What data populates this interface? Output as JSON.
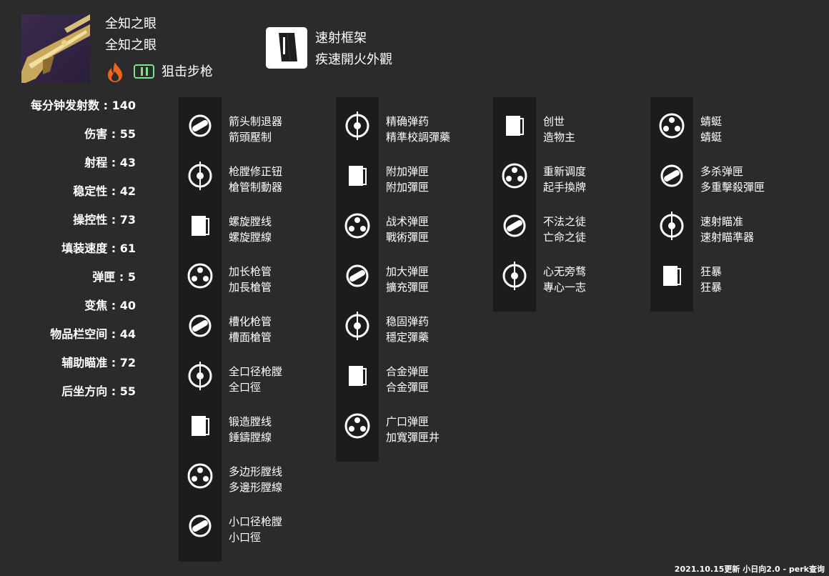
{
  "weapon": {
    "name_cn": "全知之眼",
    "name_tw": "全知之眼",
    "type": "狙击步枪",
    "element": "solar-icon",
    "ammo": "special-ammo-icon",
    "colors": {
      "solar": "#f0631e",
      "special": "#7be38c",
      "image_bg": "#3b2b4e"
    }
  },
  "frame": {
    "icon": "rapid-fire-frame-icon",
    "name_cn": "速射框架",
    "name_tw": "疾速開火外觀"
  },
  "stats": [
    {
      "label": "每分钟发射数",
      "value": "140"
    },
    {
      "label": "伤害",
      "value": "55"
    },
    {
      "label": "射程",
      "value": "43"
    },
    {
      "label": "稳定性",
      "value": "42"
    },
    {
      "label": "操控性",
      "value": "73"
    },
    {
      "label": "填装速度",
      "value": "61"
    },
    {
      "label": "弹匣",
      "value": "5"
    },
    {
      "label": "变焦",
      "value": "40"
    },
    {
      "label": "物品栏空间",
      "value": "44"
    },
    {
      "label": "辅助瞄准",
      "value": "72"
    },
    {
      "label": "后坐方向",
      "value": "55"
    }
  ],
  "columns": [
    {
      "id": "barrels",
      "perks": [
        {
          "cn": "箭头制退器",
          "tw": "箭頭壓制",
          "icon": "arrowhead-brake-icon"
        },
        {
          "cn": "枪膛修正钮",
          "tw": "槍管制動器",
          "icon": "corkscrew-rifling-icon"
        },
        {
          "cn": "螺旋膛线",
          "tw": "螺旋膛線",
          "icon": "rifling-icon"
        },
        {
          "cn": "加长枪管",
          "tw": "加長槍管",
          "icon": "extended-barrel-icon"
        },
        {
          "cn": "槽化枪管",
          "tw": "槽面槍管",
          "icon": "fluted-barrel-icon"
        },
        {
          "cn": "全口径枪膛",
          "tw": "全口徑",
          "icon": "full-bore-icon"
        },
        {
          "cn": "锻造膛线",
          "tw": "錘鑄膛線",
          "icon": "hammer-forged-icon"
        },
        {
          "cn": "多边形膛线",
          "tw": "多邊形膛線",
          "icon": "polygonal-rifling-icon"
        },
        {
          "cn": "小口径枪膛",
          "tw": "小口徑",
          "icon": "smallbore-icon"
        }
      ]
    },
    {
      "id": "magazines",
      "perks": [
        {
          "cn": "精确弹药",
          "tw": "精準校調彈藥",
          "icon": "accurized-rounds-icon"
        },
        {
          "cn": "附加弹匣",
          "tw": "附加彈匣",
          "icon": "appended-mag-icon"
        },
        {
          "cn": "战术弹匣",
          "tw": "戰術彈匣",
          "icon": "tactical-mag-icon"
        },
        {
          "cn": "加大弹匣",
          "tw": "擴充彈匣",
          "icon": "extended-mag-icon"
        },
        {
          "cn": "稳固弹药",
          "tw": "穩定彈藥",
          "icon": "steady-rounds-icon"
        },
        {
          "cn": "合金弹匣",
          "tw": "合金彈匣",
          "icon": "alloy-magazine-icon"
        },
        {
          "cn": "广口弹匣",
          "tw": "加寬彈匣井",
          "icon": "flared-magwell-icon"
        }
      ]
    },
    {
      "id": "trait1",
      "perks": [
        {
          "cn": "创世",
          "tw": "造物主",
          "icon": "genesis-icon"
        },
        {
          "cn": "重新调度",
          "tw": "起手換牌",
          "icon": "reconstruction-icon"
        },
        {
          "cn": "不法之徒",
          "tw": "亡命之徒",
          "icon": "outlaw-icon"
        },
        {
          "cn": "心无旁骛",
          "tw": "專心一志",
          "icon": "eye-icon"
        }
      ]
    },
    {
      "id": "trait2",
      "perks": [
        {
          "cn": "蜻蜓",
          "tw": "蜻蜓",
          "icon": "dragonfly-icon"
        },
        {
          "cn": "多杀弹匣",
          "tw": "多重擊殺彈匣",
          "icon": "multikill-clip-icon"
        },
        {
          "cn": "速射瞄准",
          "tw": "速射瞄準器",
          "icon": "snapshot-sights-icon"
        },
        {
          "cn": "狂暴",
          "tw": "狂暴",
          "icon": "frenzy-icon"
        }
      ]
    }
  ],
  "footer": "2021.10.15更新 小日向2.0 - perk查询"
}
